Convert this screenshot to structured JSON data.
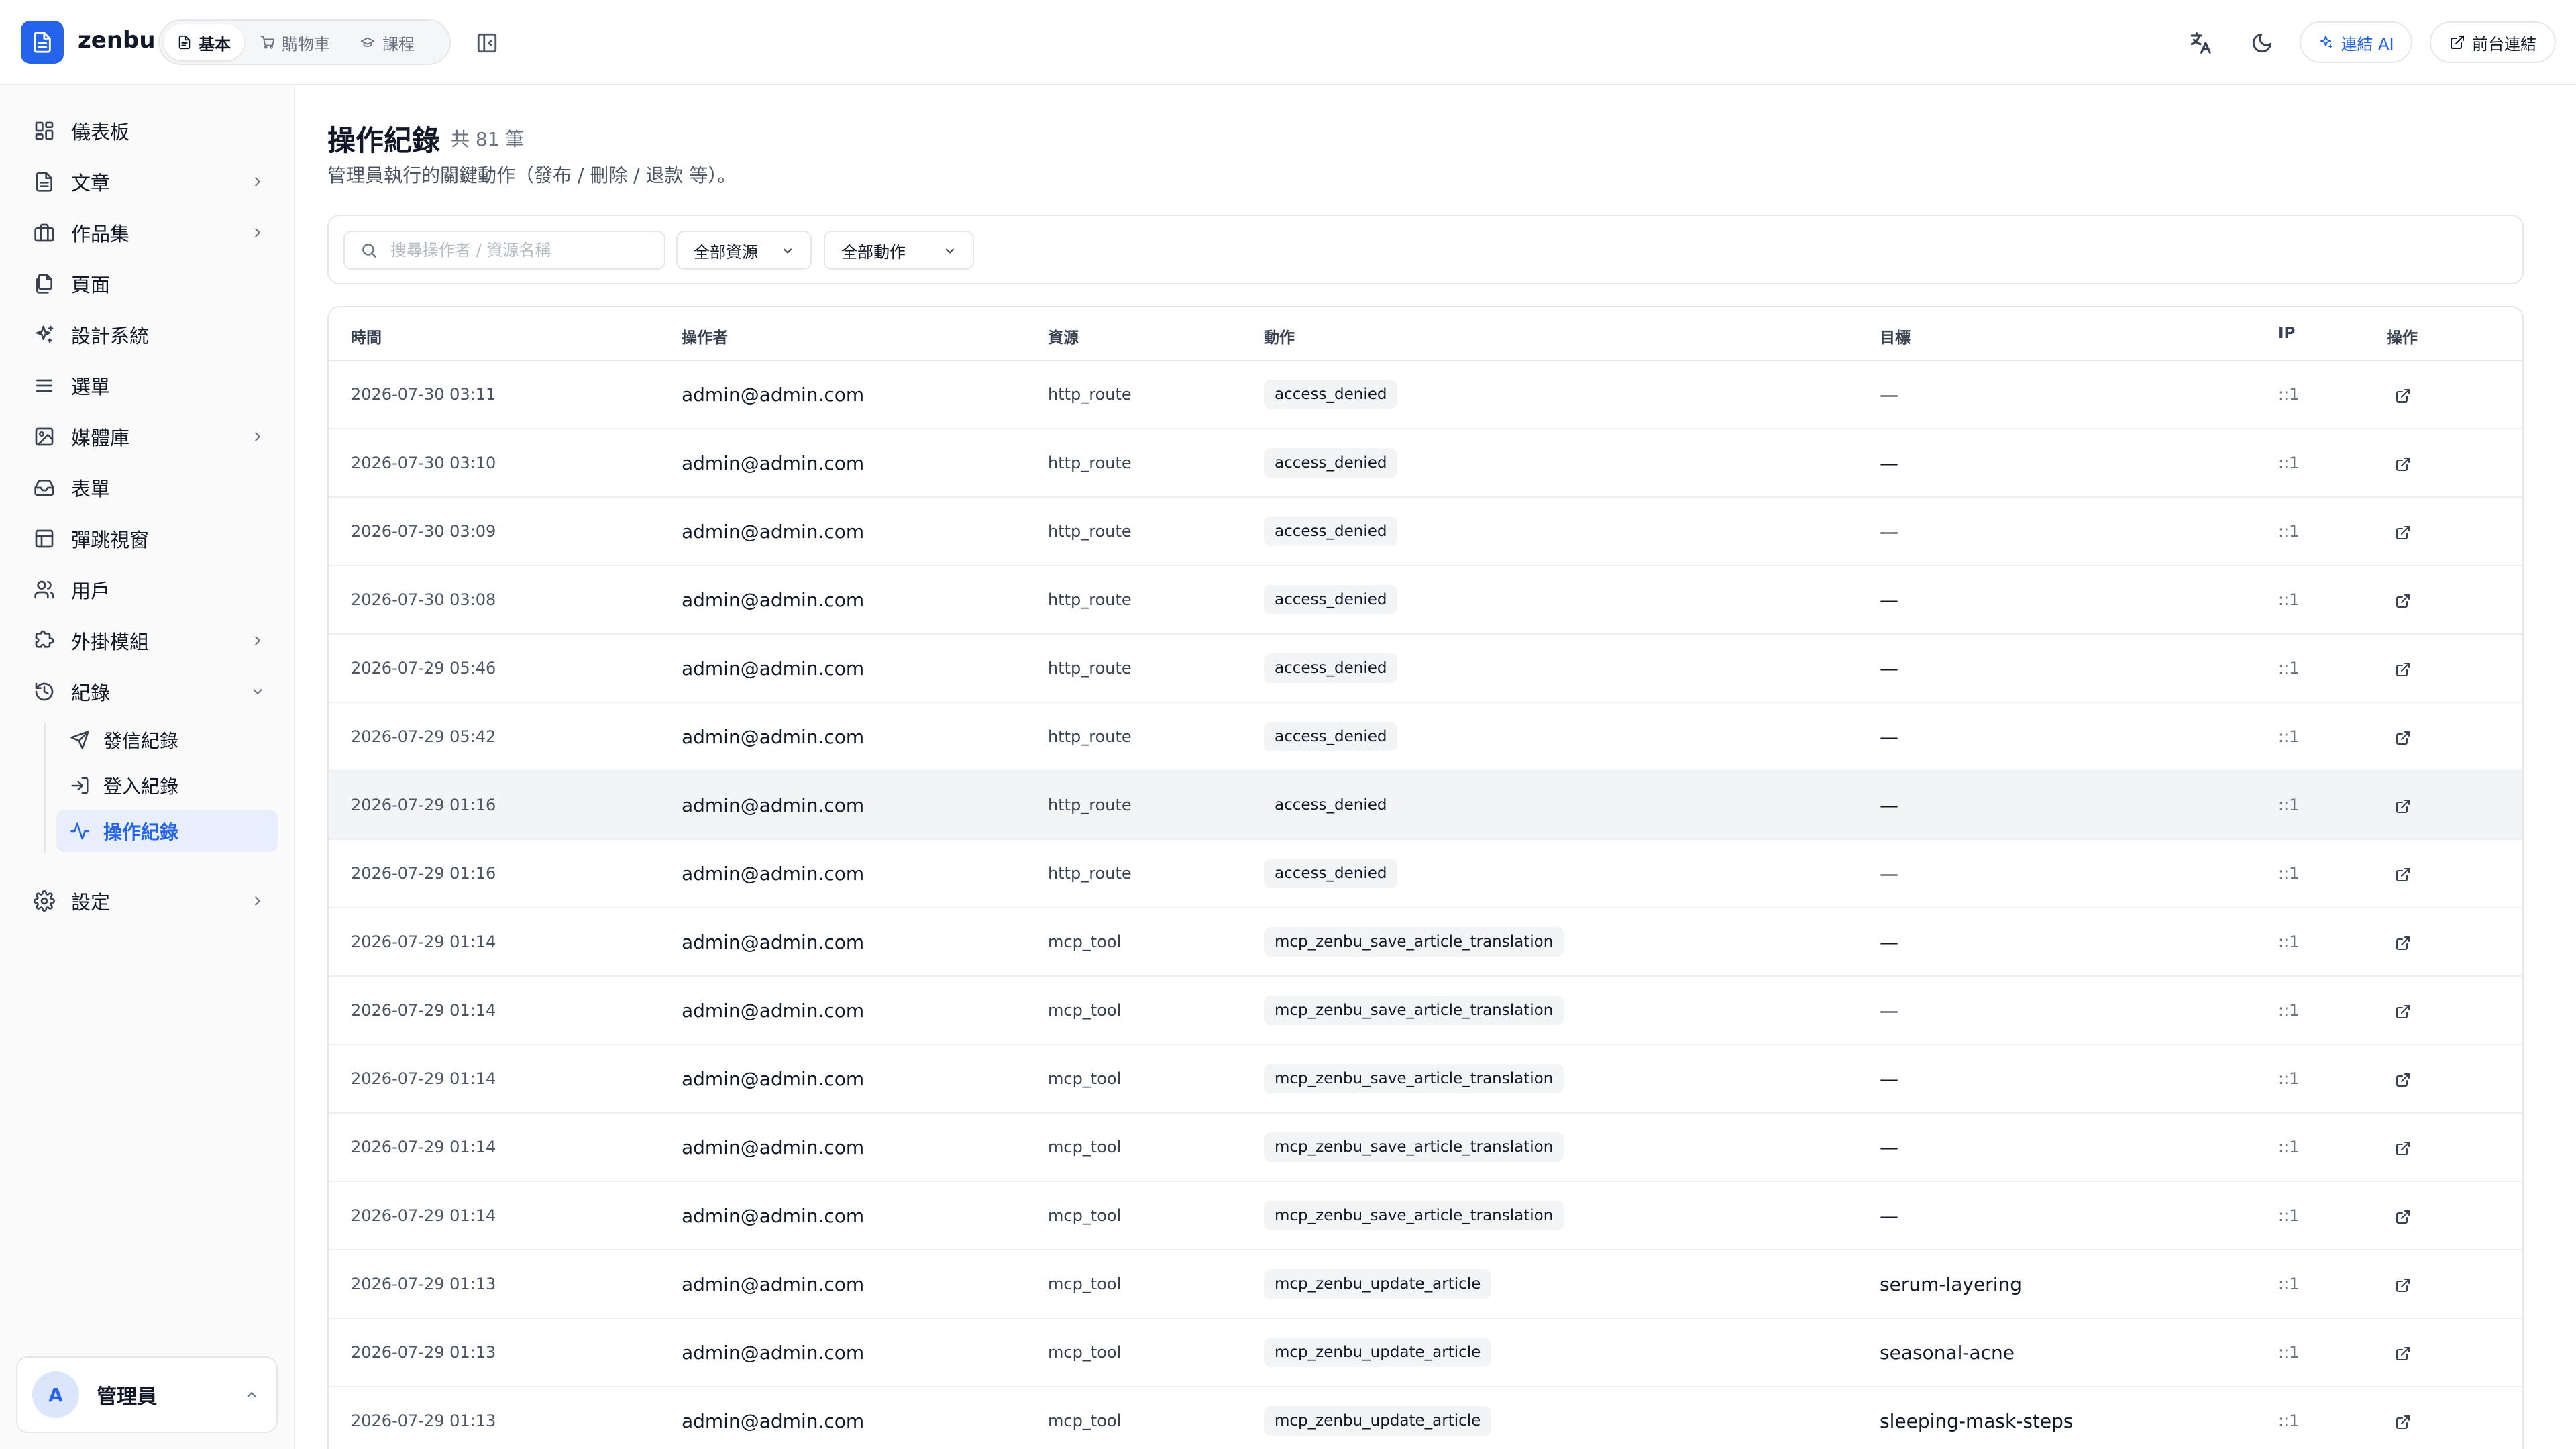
{
  "app": {
    "name": "zenbu"
  },
  "header": {
    "modes": [
      {
        "label": "基本",
        "icon": "file-icon",
        "active": true
      },
      {
        "label": "購物車",
        "icon": "cart-icon",
        "active": false
      },
      {
        "label": "課程",
        "icon": "graduation-cap-icon",
        "active": false
      }
    ],
    "connect_ai_label": "連結 AI",
    "frontend_link_label": "前台連結"
  },
  "sidebar": {
    "items": [
      {
        "label": "儀表板",
        "icon": "dashboard-icon",
        "has_chevron": false
      },
      {
        "label": "文章",
        "icon": "file-text-icon",
        "has_chevron": true
      },
      {
        "label": "作品集",
        "icon": "briefcase-icon",
        "has_chevron": true
      },
      {
        "label": "頁面",
        "icon": "pages-icon",
        "has_chevron": false
      },
      {
        "label": "設計系統",
        "icon": "sparkles-icon",
        "has_chevron": false
      },
      {
        "label": "選單",
        "icon": "menu-icon",
        "has_chevron": false
      },
      {
        "label": "媒體庫",
        "icon": "image-icon",
        "has_chevron": true
      },
      {
        "label": "表單",
        "icon": "inbox-icon",
        "has_chevron": false
      },
      {
        "label": "彈跳視窗",
        "icon": "layout-icon",
        "has_chevron": false
      },
      {
        "label": "用戶",
        "icon": "users-icon",
        "has_chevron": false
      },
      {
        "label": "外掛模組",
        "icon": "puzzle-icon",
        "has_chevron": true
      },
      {
        "label": "紀錄",
        "icon": "history-icon",
        "has_chevron": true,
        "expanded": true
      }
    ],
    "sub_items": [
      {
        "label": "發信紀錄",
        "icon": "send-icon",
        "active": false
      },
      {
        "label": "登入紀錄",
        "icon": "login-icon",
        "active": false
      },
      {
        "label": "操作紀錄",
        "icon": "activity-icon",
        "active": true
      }
    ],
    "settings": {
      "label": "設定",
      "icon": "settings-icon"
    },
    "user": {
      "initial": "A",
      "name": "管理員"
    }
  },
  "main": {
    "title": "操作紀錄",
    "count": "共 81 筆",
    "description": "管理員執行的關鍵動作（發布 / 刪除 / 退款 等）。",
    "search_placeholder": "搜尋操作者 / 資源名稱",
    "resource_filter": "全部資源",
    "action_filter": "全部動作",
    "columns": [
      "時間",
      "操作者",
      "資源",
      "動作",
      "目標",
      "IP",
      "操作"
    ],
    "rows": [
      {
        "time": "2026-07-30 03:11",
        "actor": "admin@admin.com",
        "resource": "http_route",
        "action": "access_denied",
        "target": "—",
        "ip": "::1"
      },
      {
        "time": "2026-07-30 03:10",
        "actor": "admin@admin.com",
        "resource": "http_route",
        "action": "access_denied",
        "target": "—",
        "ip": "::1"
      },
      {
        "time": "2026-07-30 03:09",
        "actor": "admin@admin.com",
        "resource": "http_route",
        "action": "access_denied",
        "target": "—",
        "ip": "::1"
      },
      {
        "time": "2026-07-30 03:08",
        "actor": "admin@admin.com",
        "resource": "http_route",
        "action": "access_denied",
        "target": "—",
        "ip": "::1"
      },
      {
        "time": "2026-07-29 05:46",
        "actor": "admin@admin.com",
        "resource": "http_route",
        "action": "access_denied",
        "target": "—",
        "ip": "::1"
      },
      {
        "time": "2026-07-29 05:42",
        "actor": "admin@admin.com",
        "resource": "http_route",
        "action": "access_denied",
        "target": "—",
        "ip": "::1"
      },
      {
        "time": "2026-07-29 01:16",
        "actor": "admin@admin.com",
        "resource": "http_route",
        "action": "access_denied",
        "target": "—",
        "ip": "::1"
      },
      {
        "time": "2026-07-29 01:16",
        "actor": "admin@admin.com",
        "resource": "http_route",
        "action": "access_denied",
        "target": "—",
        "ip": "::1"
      },
      {
        "time": "2026-07-29 01:14",
        "actor": "admin@admin.com",
        "resource": "mcp_tool",
        "action": "mcp_zenbu_save_article_translation",
        "target": "—",
        "ip": "::1"
      },
      {
        "time": "2026-07-29 01:14",
        "actor": "admin@admin.com",
        "resource": "mcp_tool",
        "action": "mcp_zenbu_save_article_translation",
        "target": "—",
        "ip": "::1"
      },
      {
        "time": "2026-07-29 01:14",
        "actor": "admin@admin.com",
        "resource": "mcp_tool",
        "action": "mcp_zenbu_save_article_translation",
        "target": "—",
        "ip": "::1"
      },
      {
        "time": "2026-07-29 01:14",
        "actor": "admin@admin.com",
        "resource": "mcp_tool",
        "action": "mcp_zenbu_save_article_translation",
        "target": "—",
        "ip": "::1"
      },
      {
        "time": "2026-07-29 01:14",
        "actor": "admin@admin.com",
        "resource": "mcp_tool",
        "action": "mcp_zenbu_save_article_translation",
        "target": "—",
        "ip": "::1"
      },
      {
        "time": "2026-07-29 01:13",
        "actor": "admin@admin.com",
        "resource": "mcp_tool",
        "action": "mcp_zenbu_update_article",
        "target": "serum-layering",
        "ip": "::1"
      },
      {
        "time": "2026-07-29 01:13",
        "actor": "admin@admin.com",
        "resource": "mcp_tool",
        "action": "mcp_zenbu_update_article",
        "target": "seasonal-acne",
        "ip": "::1"
      },
      {
        "time": "2026-07-29 01:13",
        "actor": "admin@admin.com",
        "resource": "mcp_tool",
        "action": "mcp_zenbu_update_article",
        "target": "sleeping-mask-steps",
        "ip": "::1"
      }
    ]
  },
  "colors": {
    "accent": "#2563eb",
    "accent_soft": "#e8eefc",
    "border": "#e5e7eb"
  }
}
